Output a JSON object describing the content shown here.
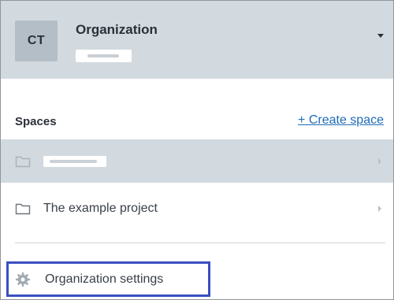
{
  "org": {
    "avatar_initials": "CT",
    "title": "Organization",
    "subtitle_redacted": true
  },
  "spaces": {
    "heading": "Spaces",
    "create_label": "+ Create space",
    "items": [
      {
        "label": "",
        "redacted": true,
        "selected": true
      },
      {
        "label": "The example project",
        "redacted": false,
        "selected": false
      }
    ]
  },
  "footer": {
    "settings_label": "Organization settings"
  },
  "icons": {
    "folder": "folder-icon",
    "gear": "gear-icon",
    "chevron_right": "chevron-right-icon",
    "caret_down": "caret-down-icon"
  },
  "colors": {
    "header_bg": "#d2dae0",
    "selected_row_bg": "#d2dae0",
    "link": "#1e6bb8",
    "highlight_border": "#3b4fc0"
  }
}
